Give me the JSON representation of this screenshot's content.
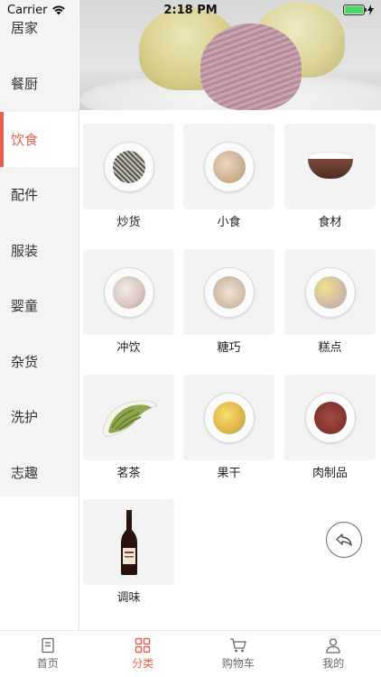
{
  "status_bar": {
    "carrier": "Carrier",
    "time": "2:18 PM"
  },
  "sidebar": {
    "items": [
      {
        "label": "居家"
      },
      {
        "label": "餐厨"
      },
      {
        "label": "饮食",
        "active": true
      },
      {
        "label": "配件"
      },
      {
        "label": "服装"
      },
      {
        "label": "婴童"
      },
      {
        "label": "杂货"
      },
      {
        "label": "洗护"
      },
      {
        "label": "志趣"
      }
    ]
  },
  "categories": [
    {
      "label": "炒货",
      "icon": "sunflower-seeds-icon"
    },
    {
      "label": "小食",
      "icon": "snack-plate-icon"
    },
    {
      "label": "食材",
      "icon": "rice-bowl-icon"
    },
    {
      "label": "冲饮",
      "icon": "drink-plate-icon"
    },
    {
      "label": "糖巧",
      "icon": "candy-plate-icon"
    },
    {
      "label": "糕点",
      "icon": "pastry-plate-icon"
    },
    {
      "label": "茗茶",
      "icon": "tea-leaves-icon"
    },
    {
      "label": "果干",
      "icon": "dried-fruit-plate-icon"
    },
    {
      "label": "肉制品",
      "icon": "jerky-plate-icon"
    },
    {
      "label": "调味",
      "icon": "sauce-bottle-icon"
    }
  ],
  "tab_bar": {
    "tabs": [
      {
        "label": "首页",
        "icon": "home-icon"
      },
      {
        "label": "分类",
        "icon": "category-icon",
        "active": true
      },
      {
        "label": "购物车",
        "icon": "cart-icon"
      },
      {
        "label": "我的",
        "icon": "profile-icon"
      }
    ]
  },
  "colors": {
    "accent": "#e8604c",
    "sidebar_bg": "#f4f4f4",
    "tile_bg": "#f3f3f3"
  }
}
